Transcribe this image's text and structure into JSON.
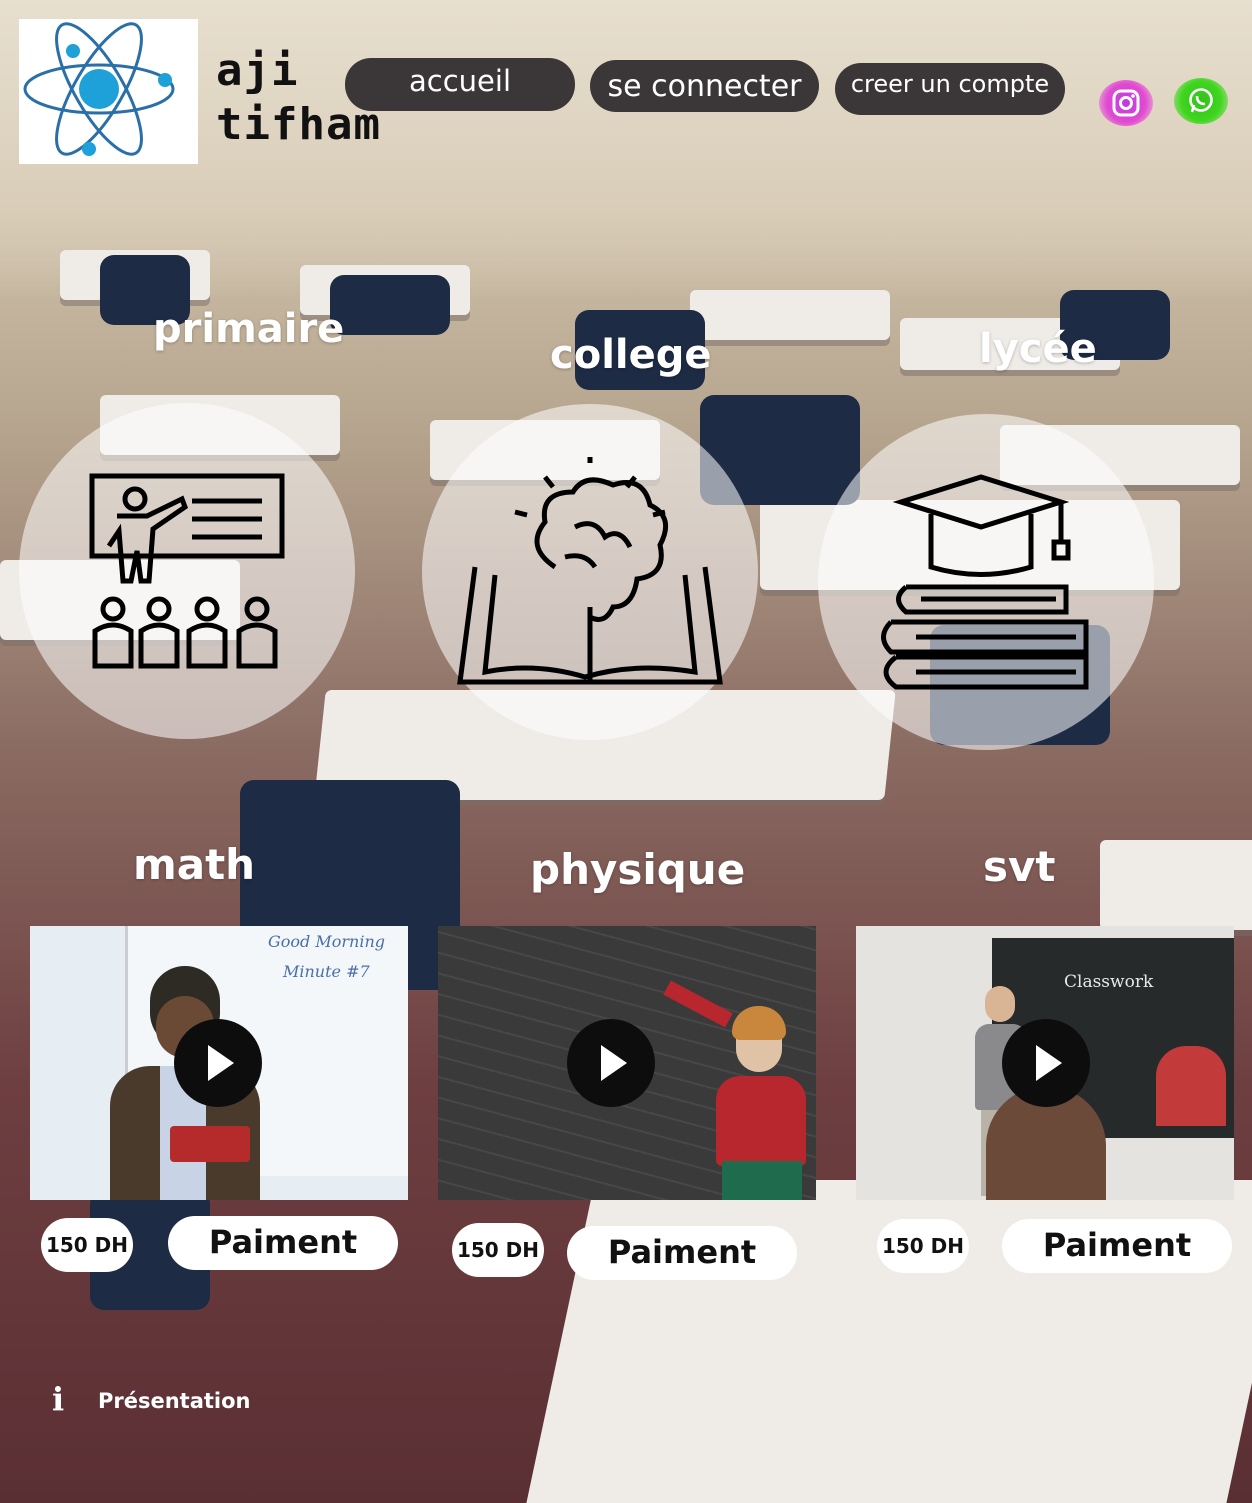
{
  "brand": {
    "line1": "aji",
    "line2": "tifham"
  },
  "nav": {
    "home": "accueil",
    "login": "se connecter",
    "signup": "creer un compte"
  },
  "social": {
    "instagram": "instagram-icon",
    "whatsapp": "whatsapp-icon"
  },
  "levels": [
    {
      "label": "primaire",
      "icon": "teacher-classroom-icon"
    },
    {
      "label": "college",
      "icon": "brain-book-icon"
    },
    {
      "label": "lycée",
      "icon": "graduation-cap-books-icon"
    }
  ],
  "subjects": [
    {
      "label": "math",
      "price": "150 DH",
      "pay_label": "Paiment",
      "whiteboard": [
        "Good Morning",
        "Minute #7"
      ]
    },
    {
      "label": "physique",
      "price": "150 DH",
      "pay_label": "Paiment"
    },
    {
      "label": "svt",
      "price": "150 DH",
      "pay_label": "Paiment",
      "board_title": "Classwork"
    }
  ],
  "footer": {
    "info_icon": "i",
    "presentation": "Présentation"
  },
  "colors": {
    "nav_bg": "#3b3738",
    "instagram": "#d04be0",
    "whatsapp": "#3fd61f"
  }
}
